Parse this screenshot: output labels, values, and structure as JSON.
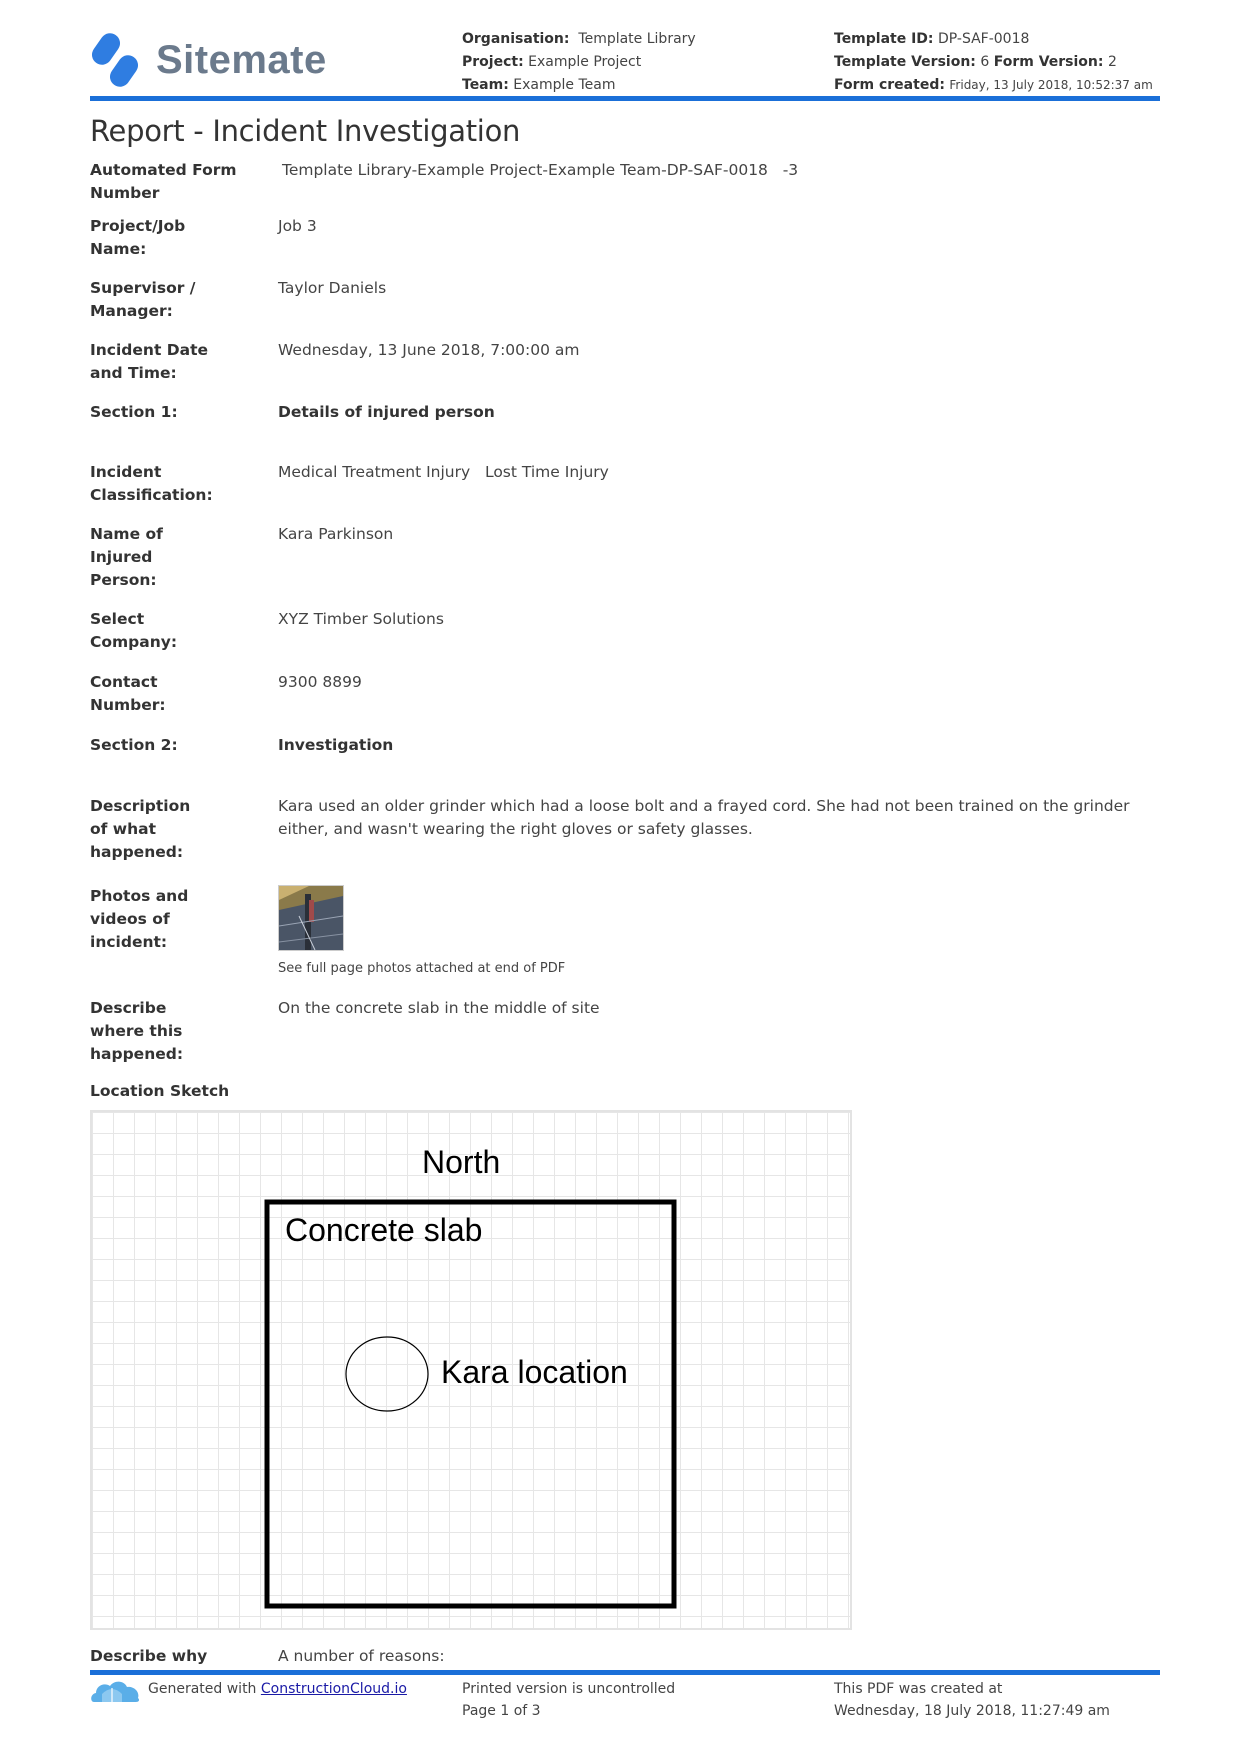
{
  "brand": {
    "name": "Sitemate",
    "accent_color": "#1a6fd8",
    "logo_icon": "sitemate-logo-icon"
  },
  "header": {
    "organisation_label": "Organisation:",
    "organisation_value": "Template Library",
    "project_label": "Project:",
    "project_value": "Example Project",
    "team_label": "Team:",
    "team_value": "Example Team",
    "template_id_label": "Template ID:",
    "template_id_value": "DP-SAF-0018",
    "template_version_label": "Template Version:",
    "template_version_value": "6",
    "form_version_label": "Form Version:",
    "form_version_value": "2",
    "form_created_label": "Form created:",
    "form_created_value": "Friday, 13 July 2018, 10:52:37 am"
  },
  "report": {
    "title": "Report - Incident Investigation",
    "fields": [
      {
        "label": "Automated Form Number",
        "value": "Template Library-Example Project-Example Team-DP-SAF-0018   -3"
      },
      {
        "label": "Project/Job Name:",
        "value": "Job 3"
      },
      {
        "label": "Supervisor / Manager:",
        "value": "Taylor Daniels"
      },
      {
        "label": "Incident Date and Time:",
        "value": "Wednesday, 13 June 2018, 7:00:00 am"
      },
      {
        "label": "Section 1:",
        "value": "Details of injured person"
      },
      {
        "label": "Incident Classification:",
        "value": "Medical Treatment Injury   Lost Time Injury"
      },
      {
        "label": "Name of Injured Person:",
        "value": "Kara Parkinson"
      },
      {
        "label": "Select Company:",
        "value": "XYZ Timber Solutions"
      },
      {
        "label": "Contact Number:",
        "value": "9300 8899"
      },
      {
        "label": "Section 2:",
        "value": "Investigation"
      },
      {
        "label": "Description of what happened:",
        "value": "Kara used an older grinder which had a loose bolt and a frayed cord. She had not been trained on the grinder either, and wasn't wearing the right gloves or safety glasses."
      },
      {
        "label": "Photos and videos of incident:",
        "value": "See full page photos attached at end of PDF"
      },
      {
        "label": "Describe where this happened:",
        "value": "On the concrete slab in the middle of site"
      },
      {
        "label": "Describe why",
        "value": "A number of reasons:"
      }
    ],
    "sketch": {
      "label": "Location Sketch",
      "north_text": "North",
      "slab_text": "Concrete slab",
      "location_text": "Kara location"
    }
  },
  "footer": {
    "generated_prefix": "Generated with",
    "generated_link": "ConstructionCloud.io",
    "uncontrolled": "Printed version is uncontrolled",
    "page": "Page 1 of 3",
    "created_label": "This PDF was created at",
    "created_value": "Wednesday, 18 July 2018, 11:27:49 am"
  }
}
